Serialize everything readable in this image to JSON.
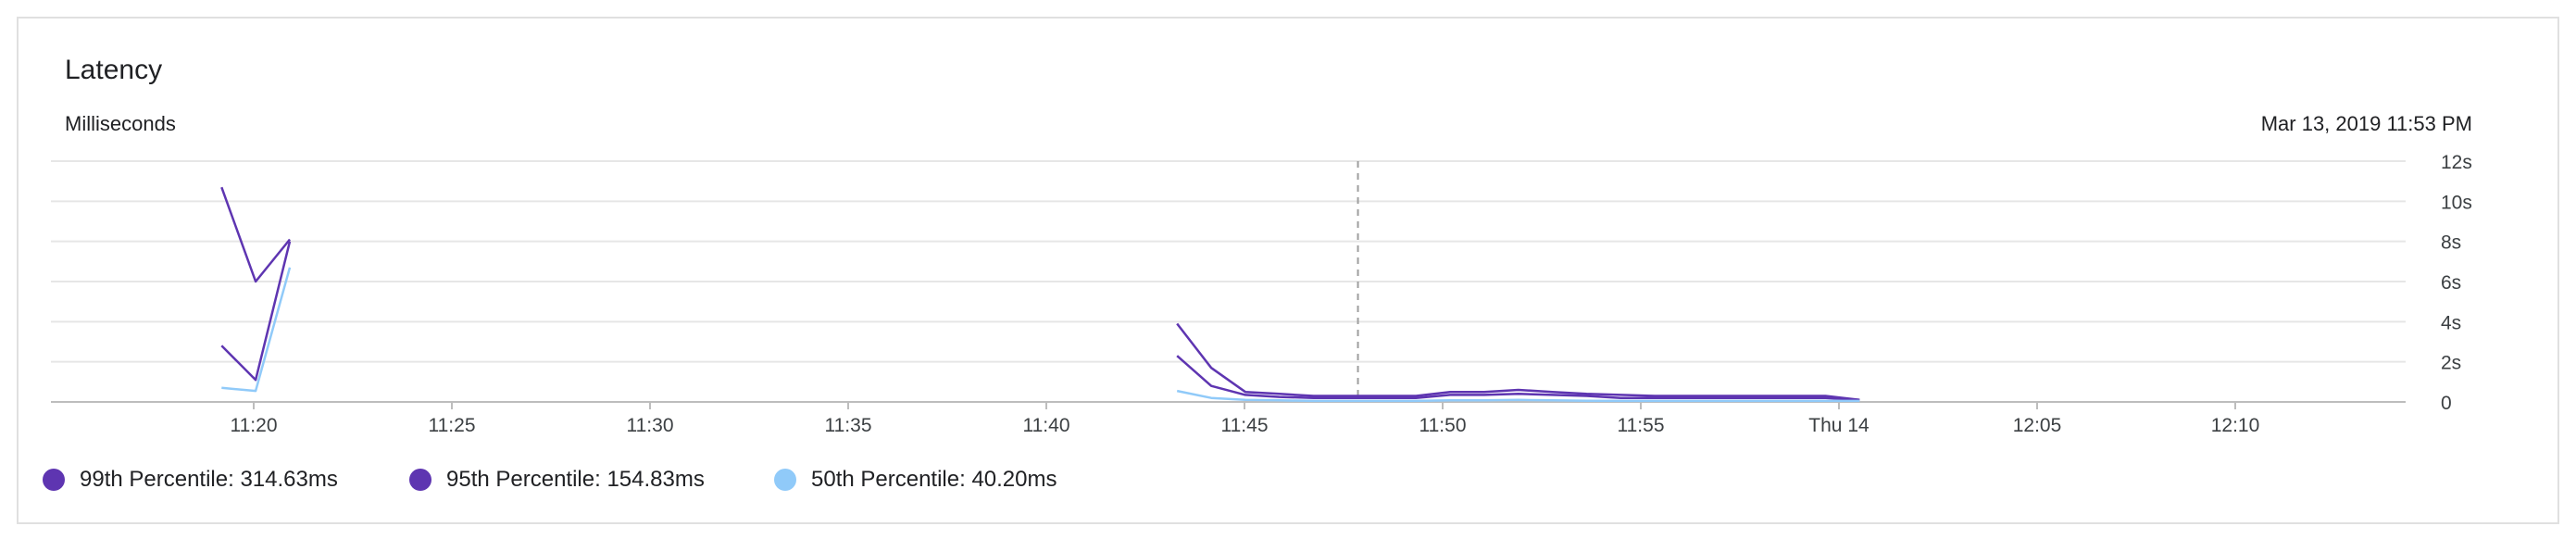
{
  "card": {
    "title": "Latency",
    "unit_label": "Milliseconds",
    "timestamp": "Mar 13, 2019 11:53 PM"
  },
  "legend": [
    {
      "label": "99th Percentile: 314.63ms",
      "color": "#5e35b1"
    },
    {
      "label": "95th Percentile: 154.83ms",
      "color": "#5e35b1"
    },
    {
      "label": "50th Percentile: 40.20ms",
      "color": "#90caf9"
    }
  ],
  "chart_data": {
    "type": "line",
    "title": "Latency",
    "ylabel": "Milliseconds",
    "x_ticks": [
      "11:20",
      "11:25",
      "11:30",
      "11:35",
      "11:40",
      "11:45",
      "11:50",
      "11:55",
      "Thu 14",
      "12:05",
      "12:10"
    ],
    "y_ticks": [
      "0",
      "2s",
      "4s",
      "6s",
      "8s",
      "10s",
      "12s"
    ],
    "ylim": [
      0,
      12
    ],
    "y_unit": "s",
    "x_unit": "minutes after 11:00",
    "xlim": [
      15,
      84
    ],
    "cursor_x": 53.3,
    "grid": true,
    "series": [
      {
        "name": "99th Percentile",
        "color": "#5e35b1",
        "segments": [
          [
            [
              20,
              10.7
            ],
            [
              21,
              6.0
            ],
            [
              22,
              8.1
            ]
          ],
          [
            [
              48,
              3.9
            ],
            [
              49,
              1.7
            ],
            [
              50,
              0.5
            ],
            [
              51,
              0.4
            ],
            [
              52,
              0.3
            ],
            [
              53,
              0.3
            ],
            [
              54,
              0.3
            ],
            [
              55,
              0.3
            ],
            [
              56,
              0.5
            ],
            [
              57,
              0.5
            ],
            [
              58,
              0.6
            ],
            [
              59,
              0.5
            ],
            [
              60,
              0.4
            ],
            [
              61,
              0.35
            ],
            [
              62,
              0.3
            ],
            [
              63,
              0.3
            ],
            [
              64,
              0.3
            ],
            [
              65,
              0.3
            ],
            [
              66,
              0.3
            ],
            [
              67,
              0.3
            ],
            [
              68,
              0.1
            ]
          ]
        ]
      },
      {
        "name": "95th Percentile",
        "color": "#5e35b1",
        "segments": [
          [
            [
              20,
              2.8
            ],
            [
              21,
              1.1
            ],
            [
              22,
              8.0
            ]
          ],
          [
            [
              48,
              2.3
            ],
            [
              49,
              0.8
            ],
            [
              50,
              0.35
            ],
            [
              51,
              0.25
            ],
            [
              52,
              0.2
            ],
            [
              53,
              0.2
            ],
            [
              54,
              0.2
            ],
            [
              55,
              0.2
            ],
            [
              56,
              0.35
            ],
            [
              57,
              0.35
            ],
            [
              58,
              0.4
            ],
            [
              59,
              0.35
            ],
            [
              60,
              0.3
            ],
            [
              61,
              0.2
            ],
            [
              62,
              0.2
            ],
            [
              63,
              0.2
            ],
            [
              64,
              0.2
            ],
            [
              65,
              0.2
            ],
            [
              66,
              0.2
            ],
            [
              67,
              0.2
            ],
            [
              68,
              0.1
            ]
          ]
        ]
      },
      {
        "name": "50th Percentile",
        "color": "#90caf9",
        "segments": [
          [
            [
              20,
              0.7
            ],
            [
              21,
              0.55
            ],
            [
              22,
              6.7
            ]
          ],
          [
            [
              48,
              0.55
            ],
            [
              49,
              0.2
            ],
            [
              50,
              0.1
            ],
            [
              51,
              0.08
            ],
            [
              52,
              0.05
            ],
            [
              53,
              0.05
            ],
            [
              54,
              0.05
            ],
            [
              55,
              0.05
            ],
            [
              56,
              0.08
            ],
            [
              57,
              0.08
            ],
            [
              58,
              0.1
            ],
            [
              59,
              0.08
            ],
            [
              60,
              0.06
            ],
            [
              61,
              0.05
            ],
            [
              62,
              0.05
            ],
            [
              63,
              0.05
            ],
            [
              64,
              0.05
            ],
            [
              65,
              0.05
            ],
            [
              66,
              0.05
            ],
            [
              67,
              0.05
            ],
            [
              68,
              0.05
            ]
          ]
        ]
      }
    ]
  }
}
